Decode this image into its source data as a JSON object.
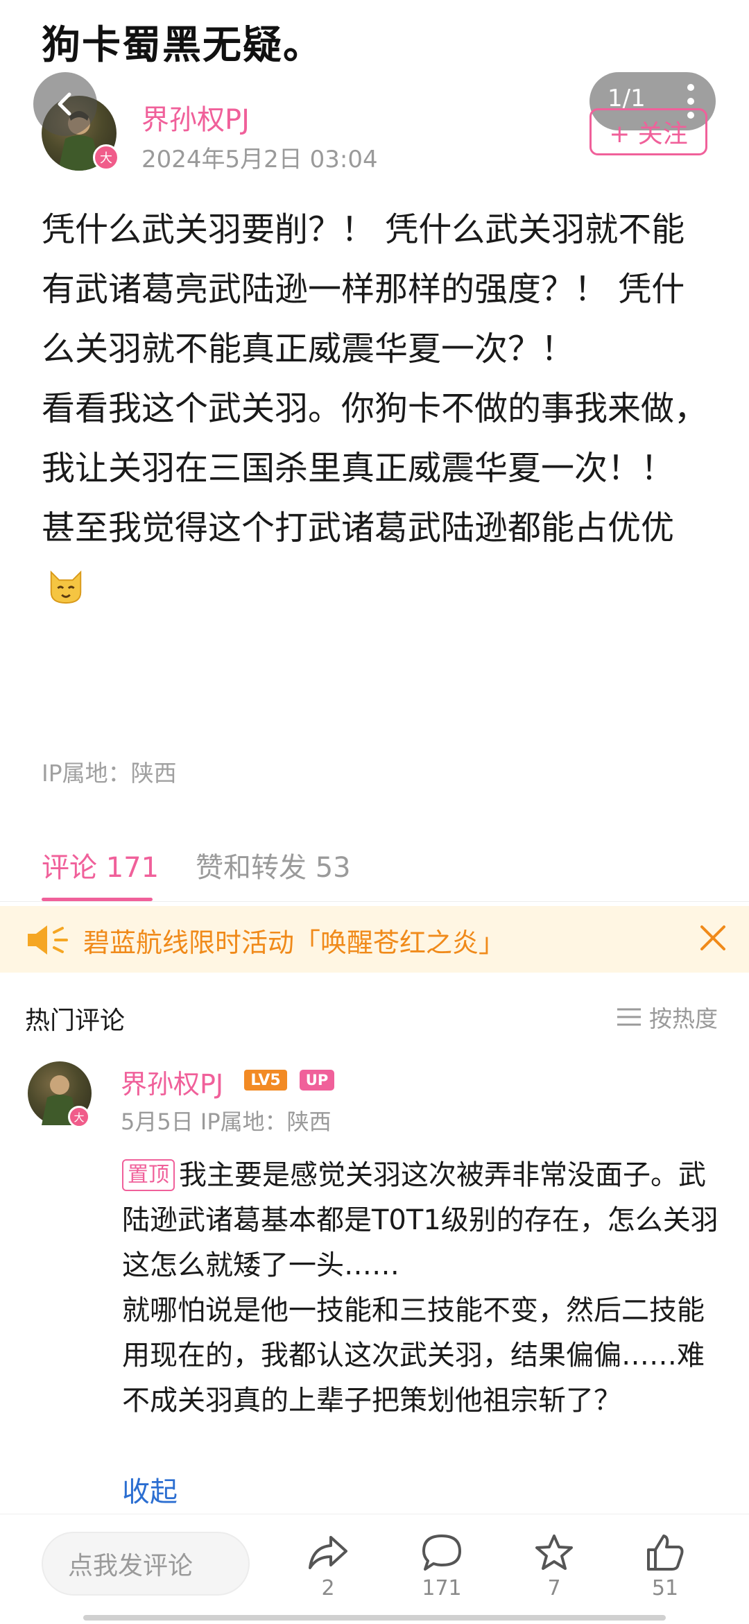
{
  "post": {
    "title_partial": "狗卡蜀黑无疑。",
    "author": "界孙权PJ",
    "avatar_badge": "大",
    "date": "2024年5月2日 03:04",
    "page_indicator": "1/1",
    "follow_label": "+ 关注",
    "paragraphs": [
      "凭什么武关羽要削？！ 凭什么武关羽就不能有武诸葛亮武陆逊一样那样的强度？！ 凭什么关羽就不能真正威震华夏一次？！",
      "看看我这个武关羽。你狗卡不做的事我来做，我让关羽在三国杀里真正威震华夏一次！！",
      "甚至我觉得这个打武诸葛武陆逊都能占优"
    ],
    "ip_location": "IP属地：陕西"
  },
  "tabs": {
    "comments_label": "评论 171",
    "likes_reposts_label": "赞和转发 53"
  },
  "banner": {
    "text": "碧蓝航线限时活动「唤醒苍红之炎」"
  },
  "comments_section": {
    "title": "热门评论",
    "sort_label": "按热度"
  },
  "comment": {
    "author": "界孙权PJ",
    "avatar_badge": "大",
    "level_badge": "LV5",
    "up_badge": "UP",
    "meta": "5月5日  IP属地：陕西",
    "pin_tag": "置顶",
    "text_1": "我主要是感觉关羽这次被弄非常没面子。武陆逊武诸葛基本都是T0T1级别的存在，怎么关羽这怎么就矮了一头……",
    "text_2": "就哪怕说是他一技能和三技能不变，然后二技能用现在的，我都认这次武关羽，结果偏偏……难不成关羽真的上辈子把策划他祖宗斩了？",
    "collapse_label": "收起"
  },
  "bottom_bar": {
    "input_placeholder": "点我发评论",
    "share_count": "2",
    "comment_count": "171",
    "star_count": "7",
    "like_count": "51"
  },
  "colors": {
    "accent_pink": "#f0609a",
    "banner_orange": "#f08a1a",
    "link_blue": "#2b6ed1"
  }
}
